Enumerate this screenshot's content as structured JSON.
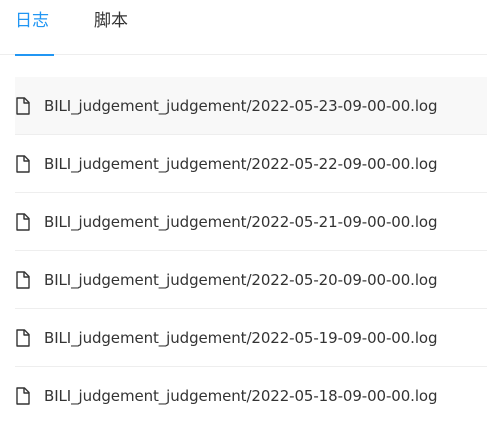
{
  "tabs": [
    {
      "label": "日志",
      "active": true
    },
    {
      "label": "脚本",
      "active": false
    }
  ],
  "files": [
    {
      "icon": "file-icon",
      "name": "BILI_judgement_judgement/2022-05-23-09-00-00.log"
    },
    {
      "icon": "file-icon",
      "name": "BILI_judgement_judgement/2022-05-22-09-00-00.log"
    },
    {
      "icon": "file-icon",
      "name": "BILI_judgement_judgement/2022-05-21-09-00-00.log"
    },
    {
      "icon": "file-icon",
      "name": "BILI_judgement_judgement/2022-05-20-09-00-00.log"
    },
    {
      "icon": "file-icon",
      "name": "BILI_judgement_judgement/2022-05-19-09-00-00.log"
    },
    {
      "icon": "file-icon",
      "name": "BILI_judgement_judgement/2022-05-18-09-00-00.log"
    }
  ],
  "colors": {
    "accent": "#2196f3",
    "text": "#333333",
    "divider": "#eeeeee",
    "hover_row": "#f8f8f8"
  }
}
